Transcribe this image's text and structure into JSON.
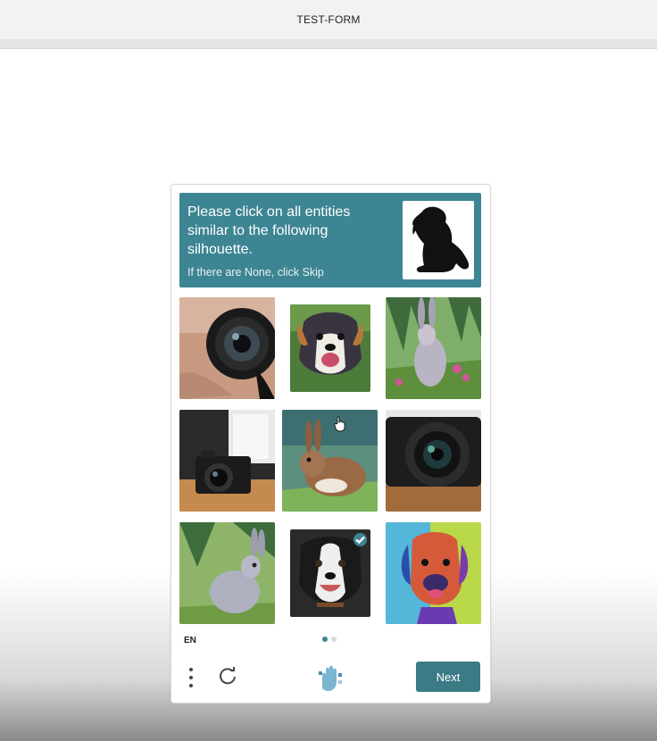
{
  "window": {
    "title": "TEST-FORM"
  },
  "captcha": {
    "prompt_title": "Please click on all entities similar to the following silhouette.",
    "prompt_sub": "If there are None, click Skip",
    "silhouette_icon": "dog-silhouette-icon",
    "tiles": [
      {
        "subject": "camera lens",
        "selected": false
      },
      {
        "subject": "dog",
        "selected": false
      },
      {
        "subject": "rabbit",
        "selected": false
      },
      {
        "subject": "camera",
        "selected": false
      },
      {
        "subject": "rabbit",
        "selected": false
      },
      {
        "subject": "camera lens",
        "selected": false
      },
      {
        "subject": "rabbit",
        "selected": false
      },
      {
        "subject": "dog",
        "selected": true
      },
      {
        "subject": "dog",
        "selected": false
      }
    ],
    "language": "EN",
    "page_count": 2,
    "current_page": 1,
    "next_label": "Next",
    "colors": {
      "accent": "#3d8593",
      "button": "#3a7b86"
    }
  }
}
